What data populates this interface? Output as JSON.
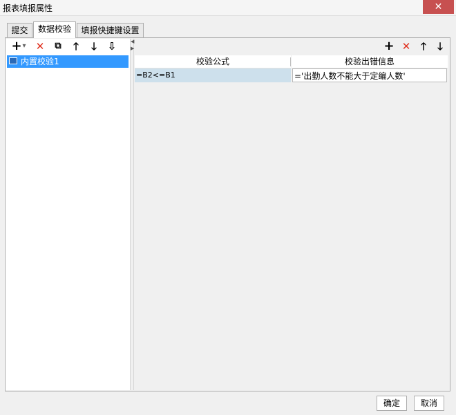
{
  "window": {
    "title": "报表填报属性",
    "close_icon": "close-icon"
  },
  "tabs": [
    {
      "label": "提交",
      "active": false
    },
    {
      "label": "数据校验",
      "active": true
    },
    {
      "label": "填报快捷键设置",
      "active": false
    }
  ],
  "left_toolbar": {
    "icons": [
      "add-icon",
      "dropdown-arrow-icon",
      "delete-icon",
      "copy-icon",
      "move-up-icon",
      "move-down-icon",
      "sort-icon"
    ],
    "add_glyph": "+",
    "dropdown_glyph": "▾",
    "delete_glyph": "✕",
    "copy_glyph": "⧉",
    "up_glyph": "🡑",
    "down_glyph": "🡓",
    "sort_glyph": "⇩"
  },
  "tree": {
    "items": [
      {
        "label": "内置校验1",
        "selected": true
      }
    ]
  },
  "right_toolbar": {
    "icons": [
      "add-icon",
      "delete-icon",
      "move-up-icon",
      "move-down-icon"
    ],
    "add_glyph": "+",
    "delete_glyph": "✕",
    "up_glyph": "🡑",
    "down_glyph": "🡓"
  },
  "grid": {
    "columns": [
      "校验公式",
      "校验出错信息"
    ],
    "rows": [
      {
        "formula": "=B2<=B1",
        "message": "='出勤人数不能大于定编人数'"
      }
    ]
  },
  "footer": {
    "ok_label": "确定",
    "cancel_label": "取消"
  },
  "colors": {
    "selection": "#3399ff",
    "close": "#c75050",
    "delete": "#e0301e",
    "formula_cell": "#cde0ec"
  }
}
